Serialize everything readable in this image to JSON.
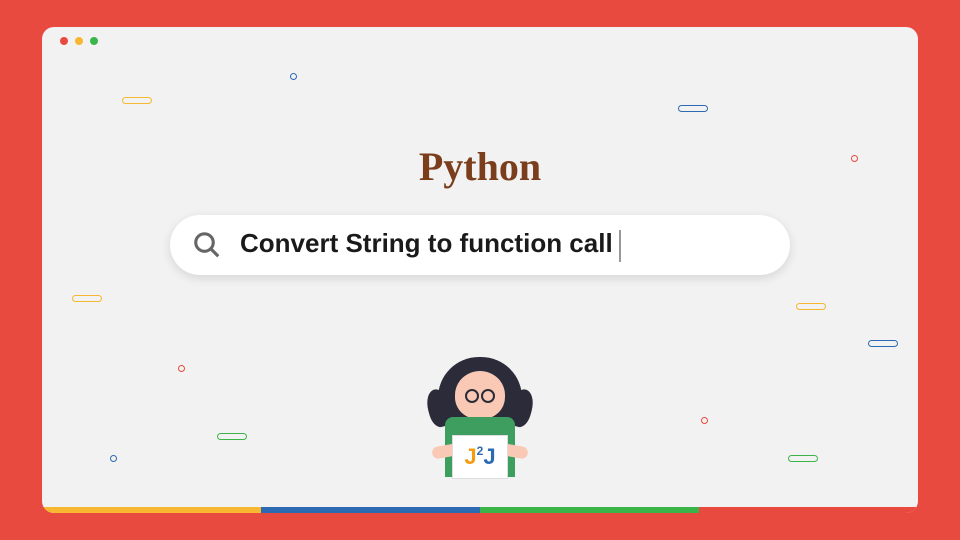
{
  "title": "Python",
  "search": {
    "query": "Convert String to function call"
  },
  "logo": {
    "j1": "J",
    "superscript": "2",
    "j2": "J"
  },
  "colors": {
    "border": "#e94a3f",
    "title": "#7a3e1d",
    "stripe_yellow": "#f7b731",
    "stripe_blue": "#2c6bb3",
    "stripe_green": "#3bb54a",
    "stripe_red": "#e94a3f"
  }
}
